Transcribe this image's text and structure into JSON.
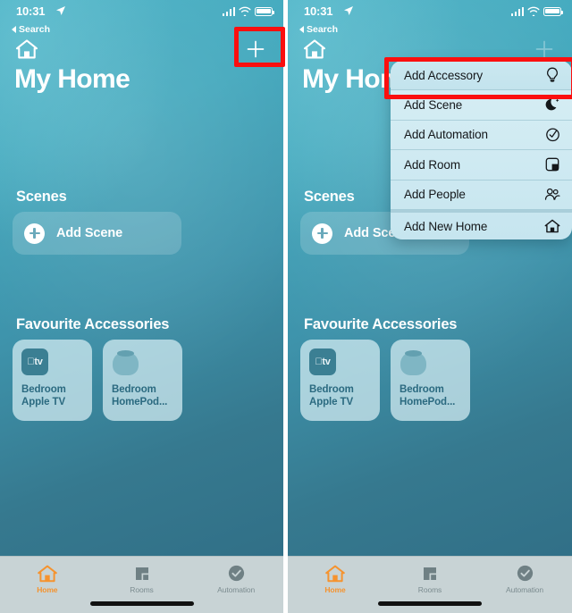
{
  "status_bar": {
    "time": "10:31",
    "location_icon": "location-arrow-icon",
    "signal_icon": "cellular-signal-icon",
    "wifi_icon": "wifi-icon",
    "battery_icon": "battery-full-icon"
  },
  "back_link": {
    "label": "Search"
  },
  "nav": {
    "home_icon": "home-icon",
    "add_button_label": "+"
  },
  "header": {
    "title": "My Home"
  },
  "sections": {
    "scenes": {
      "title": "Scenes",
      "add_scene": {
        "label": "Add Scene",
        "icon": "plus-circle-icon"
      }
    },
    "favourites": {
      "title": "Favourite Accessories",
      "items": [
        {
          "name_line1": "Bedroom",
          "name_line2": "Apple TV",
          "icon": "apple-tv-icon",
          "icon_text": "tv"
        },
        {
          "name_line1": "Bedroom",
          "name_line2": "HomePod...",
          "icon": "homepod-icon"
        }
      ]
    }
  },
  "tab_bar": {
    "tabs": [
      {
        "label": "Home",
        "icon": "home-tab-icon",
        "active": true
      },
      {
        "label": "Rooms",
        "icon": "rooms-tab-icon",
        "active": false
      },
      {
        "label": "Automation",
        "icon": "automation-tab-icon",
        "active": false
      }
    ]
  },
  "context_menu": {
    "items": [
      {
        "label": "Add Accessory",
        "icon": "lightbulb-icon",
        "highlighted": true
      },
      {
        "label": "Add Scene",
        "icon": "moon-stars-icon",
        "highlighted": false
      },
      {
        "label": "Add Automation",
        "icon": "clock-check-icon",
        "highlighted": false
      },
      {
        "label": "Add Room",
        "icon": "room-square-icon",
        "highlighted": false
      },
      {
        "label": "Add People",
        "icon": "people-icon",
        "highlighted": false
      },
      {
        "label": "Add New Home",
        "icon": "house-icon",
        "highlighted": false
      }
    ]
  },
  "annotations": {
    "accent_color": "#fb0f0f",
    "active_tab_color": "#f5932f",
    "boxes": [
      {
        "name": "add-button-highlight",
        "target": "nav.add_button"
      },
      {
        "name": "add-accessory-highlight",
        "target": "context_menu.items.0"
      }
    ]
  }
}
